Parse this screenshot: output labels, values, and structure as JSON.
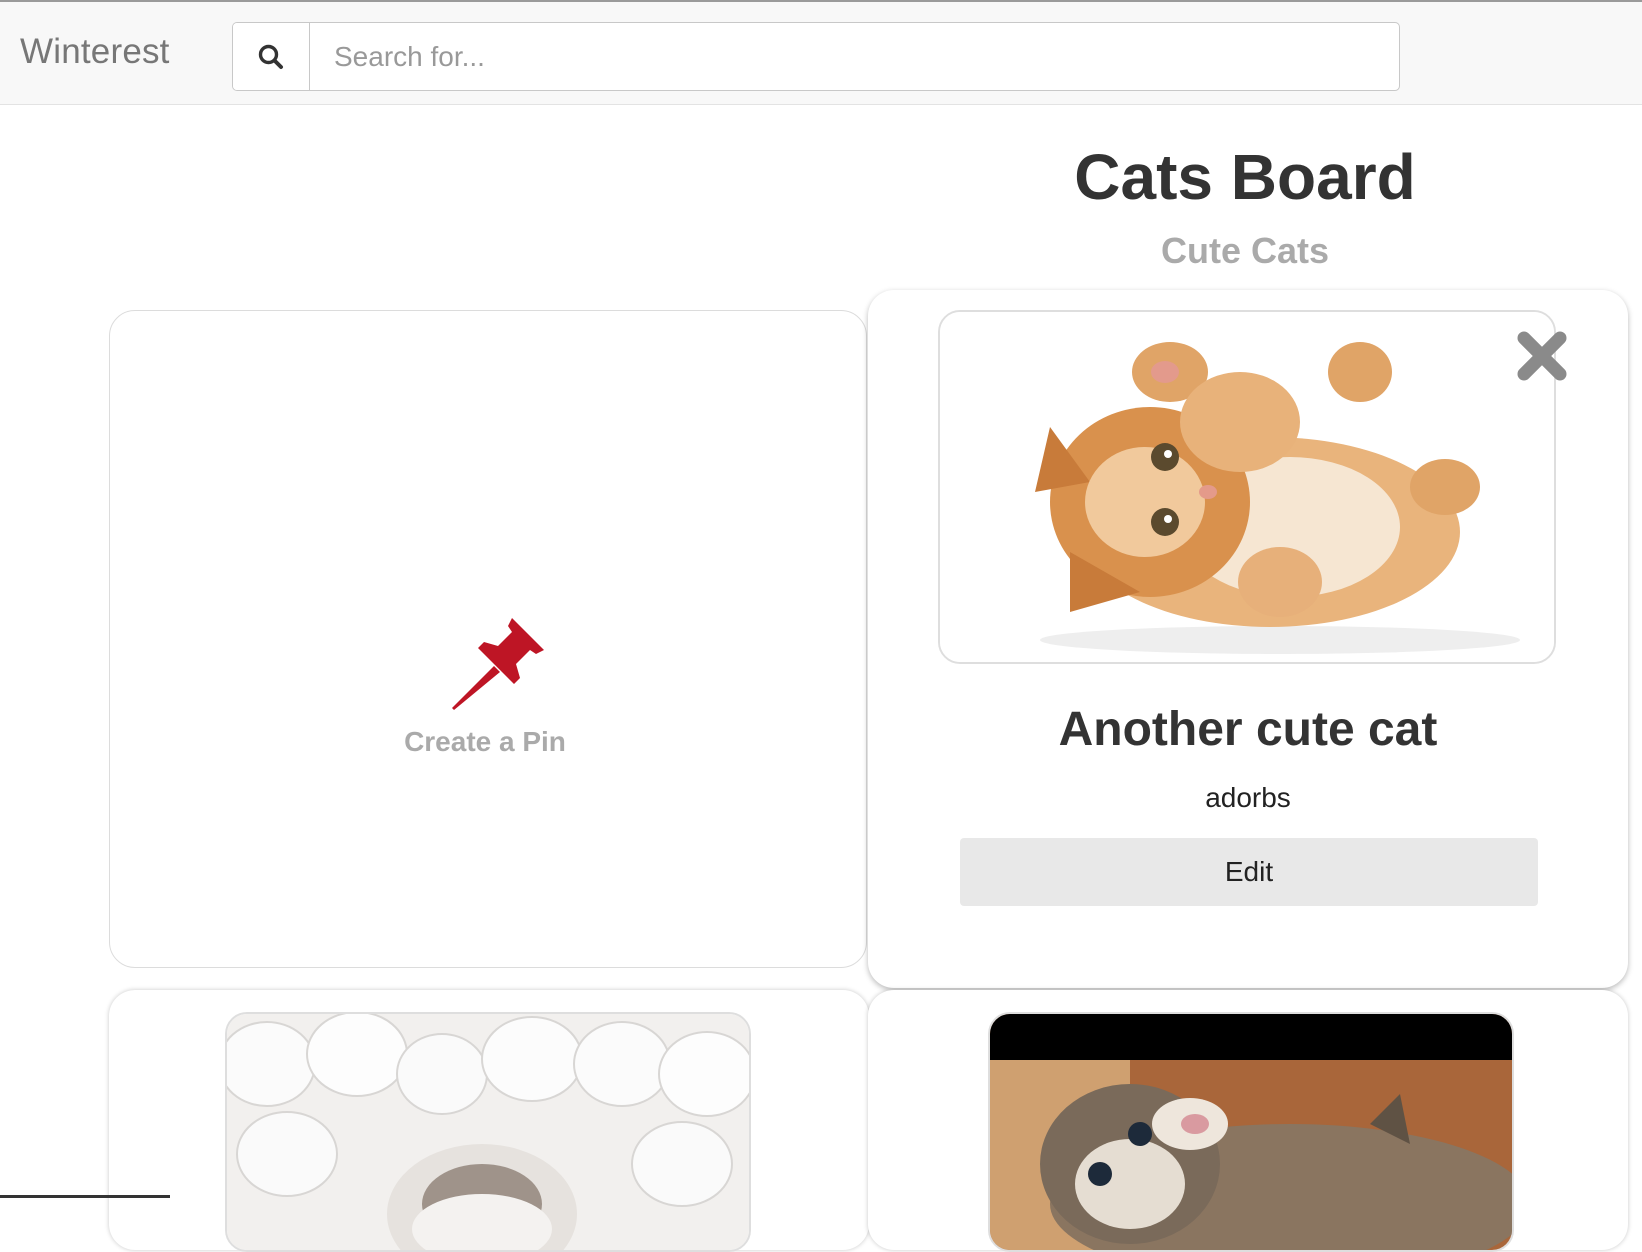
{
  "navbar": {
    "brand": "Winterest",
    "search": {
      "placeholder": "Search for...",
      "value": ""
    }
  },
  "board": {
    "title": "Cats Board",
    "subtitle": "Cute Cats"
  },
  "create_pin": {
    "label": "Create a Pin",
    "icon": "pushpin-icon",
    "icon_color": "#be1525"
  },
  "pins": [
    {
      "title": "Another cute cat",
      "description": "adorbs",
      "edit_label": "Edit",
      "image": "ginger-kitten-photo"
    },
    {
      "image": "kitten-in-marshmallows-photo"
    },
    {
      "image": "tabby-kitten-photo"
    }
  ],
  "colors": {
    "navbar_bg": "#f8f8f8",
    "brand": "#777777",
    "pushpin": "#be1525",
    "edit_button_bg": "#e8e8e8"
  }
}
